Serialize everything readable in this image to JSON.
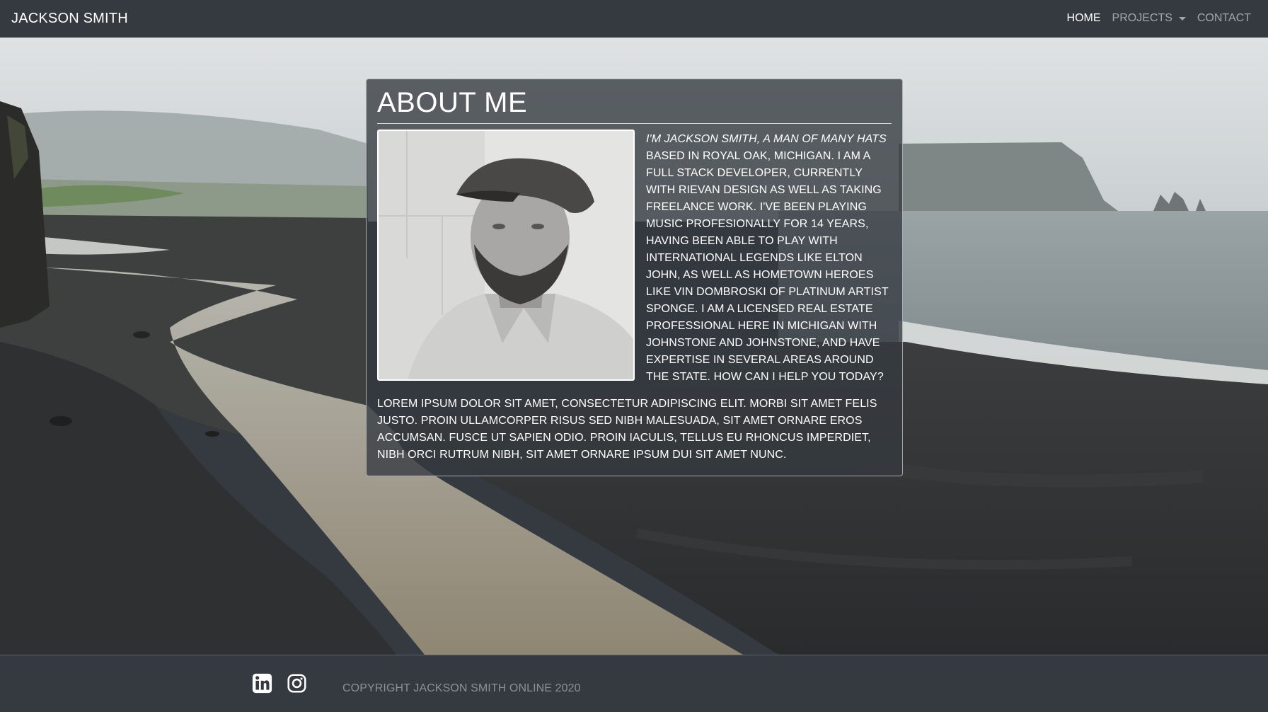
{
  "navbar": {
    "brand": "JACKSON SMITH",
    "links": [
      {
        "label": "HOME",
        "active": true
      },
      {
        "label": "PROJECTS",
        "dropdown": true
      },
      {
        "label": "CONTACT"
      }
    ]
  },
  "about": {
    "title": "ABOUT ME",
    "intro_italic": "I'm Jackson Smith, a man of many hats",
    "bio": "based in Royal Oak, Michigan. I am a full stack developer, currently with Rievan Design as well as taking freelance work. I've been playing music profesionally for 14 years, having been able to play with international legends like Elton John, as well as hometown heroes like Vin Dombroski of platinum artist Sponge. I am a licensed real estate professional here in Michigan with Johnstone and Johnstone, and have expertise in several areas around the state. How can I help you today?",
    "lorem": "Lorem ipsum dolor sit amet, consectetur adipiscing elit. Morbi sit amet felis justo. Proin ullamcorper risus sed nibh malesuada, sit amet ornare eros accumsan. Fusce ut sapien odio. Proin iaculis, tellus eu rhoncus imperdiet, nibh orci rutrum nibh, sit amet ornare ipsum dui sit amet nunc."
  },
  "footer": {
    "social": [
      {
        "icon": "linkedin-icon"
      },
      {
        "icon": "instagram-icon"
      }
    ],
    "copyright": "COPYRIGHT JACKSON SMITH ONLINE 2020"
  },
  "colors": {
    "navbar_bg": "#343a40",
    "card_bg": "#343a40",
    "text_light": "#ffffff",
    "text_muted": "#8c9196"
  }
}
